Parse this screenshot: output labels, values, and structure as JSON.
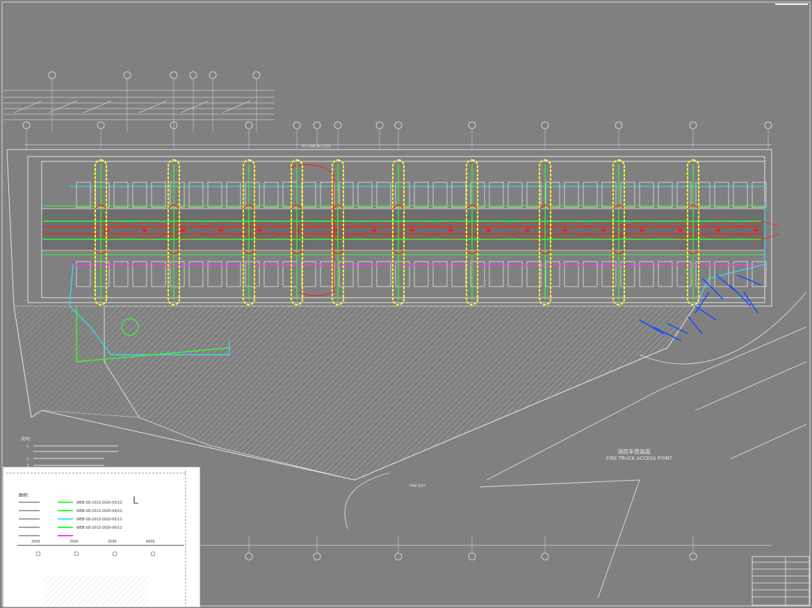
{
  "drawing": {
    "labels": {
      "fire_truck_cn": "消防车登高面",
      "fire_truck_en": "FIRE TRUCK ACCESS POINT",
      "fire_exit": "FIRE EXIT",
      "pit_line": "PIT LINE ACCESS"
    },
    "colors": {
      "background": "#808080",
      "linework": "#e6e6e6",
      "pipe_red": "#ff1a1a",
      "pipe_green": "#33ff33",
      "pipe_cyan": "#33e6ff",
      "pipe_magenta": "#ff33ff",
      "pipe_blue": "#1a4dff",
      "highlight_yellow": "#ffff33"
    }
  },
  "notes": {
    "heading": "说明：",
    "items": [
      "1.",
      "2.",
      "3.",
      "4."
    ]
  },
  "legend": {
    "title": "图例：",
    "rows": [
      {
        "color": "#33ff33",
        "code": "WEB-SD-2013-2020-03/12"
      },
      {
        "color": "#33ff33",
        "code": "WEB-SD-2013-2020-04/12"
      },
      {
        "color": "#33e6ff",
        "code": "WEB-SD-2013-2020-05/12"
      },
      {
        "color": "#33ff33",
        "code": "WEB-SD-2013-2020-06/12"
      },
      {
        "color": "#ff33ff",
        "code": ""
      }
    ],
    "scale_marks": [
      "2500",
      "2500",
      "2500",
      "6000"
    ]
  }
}
